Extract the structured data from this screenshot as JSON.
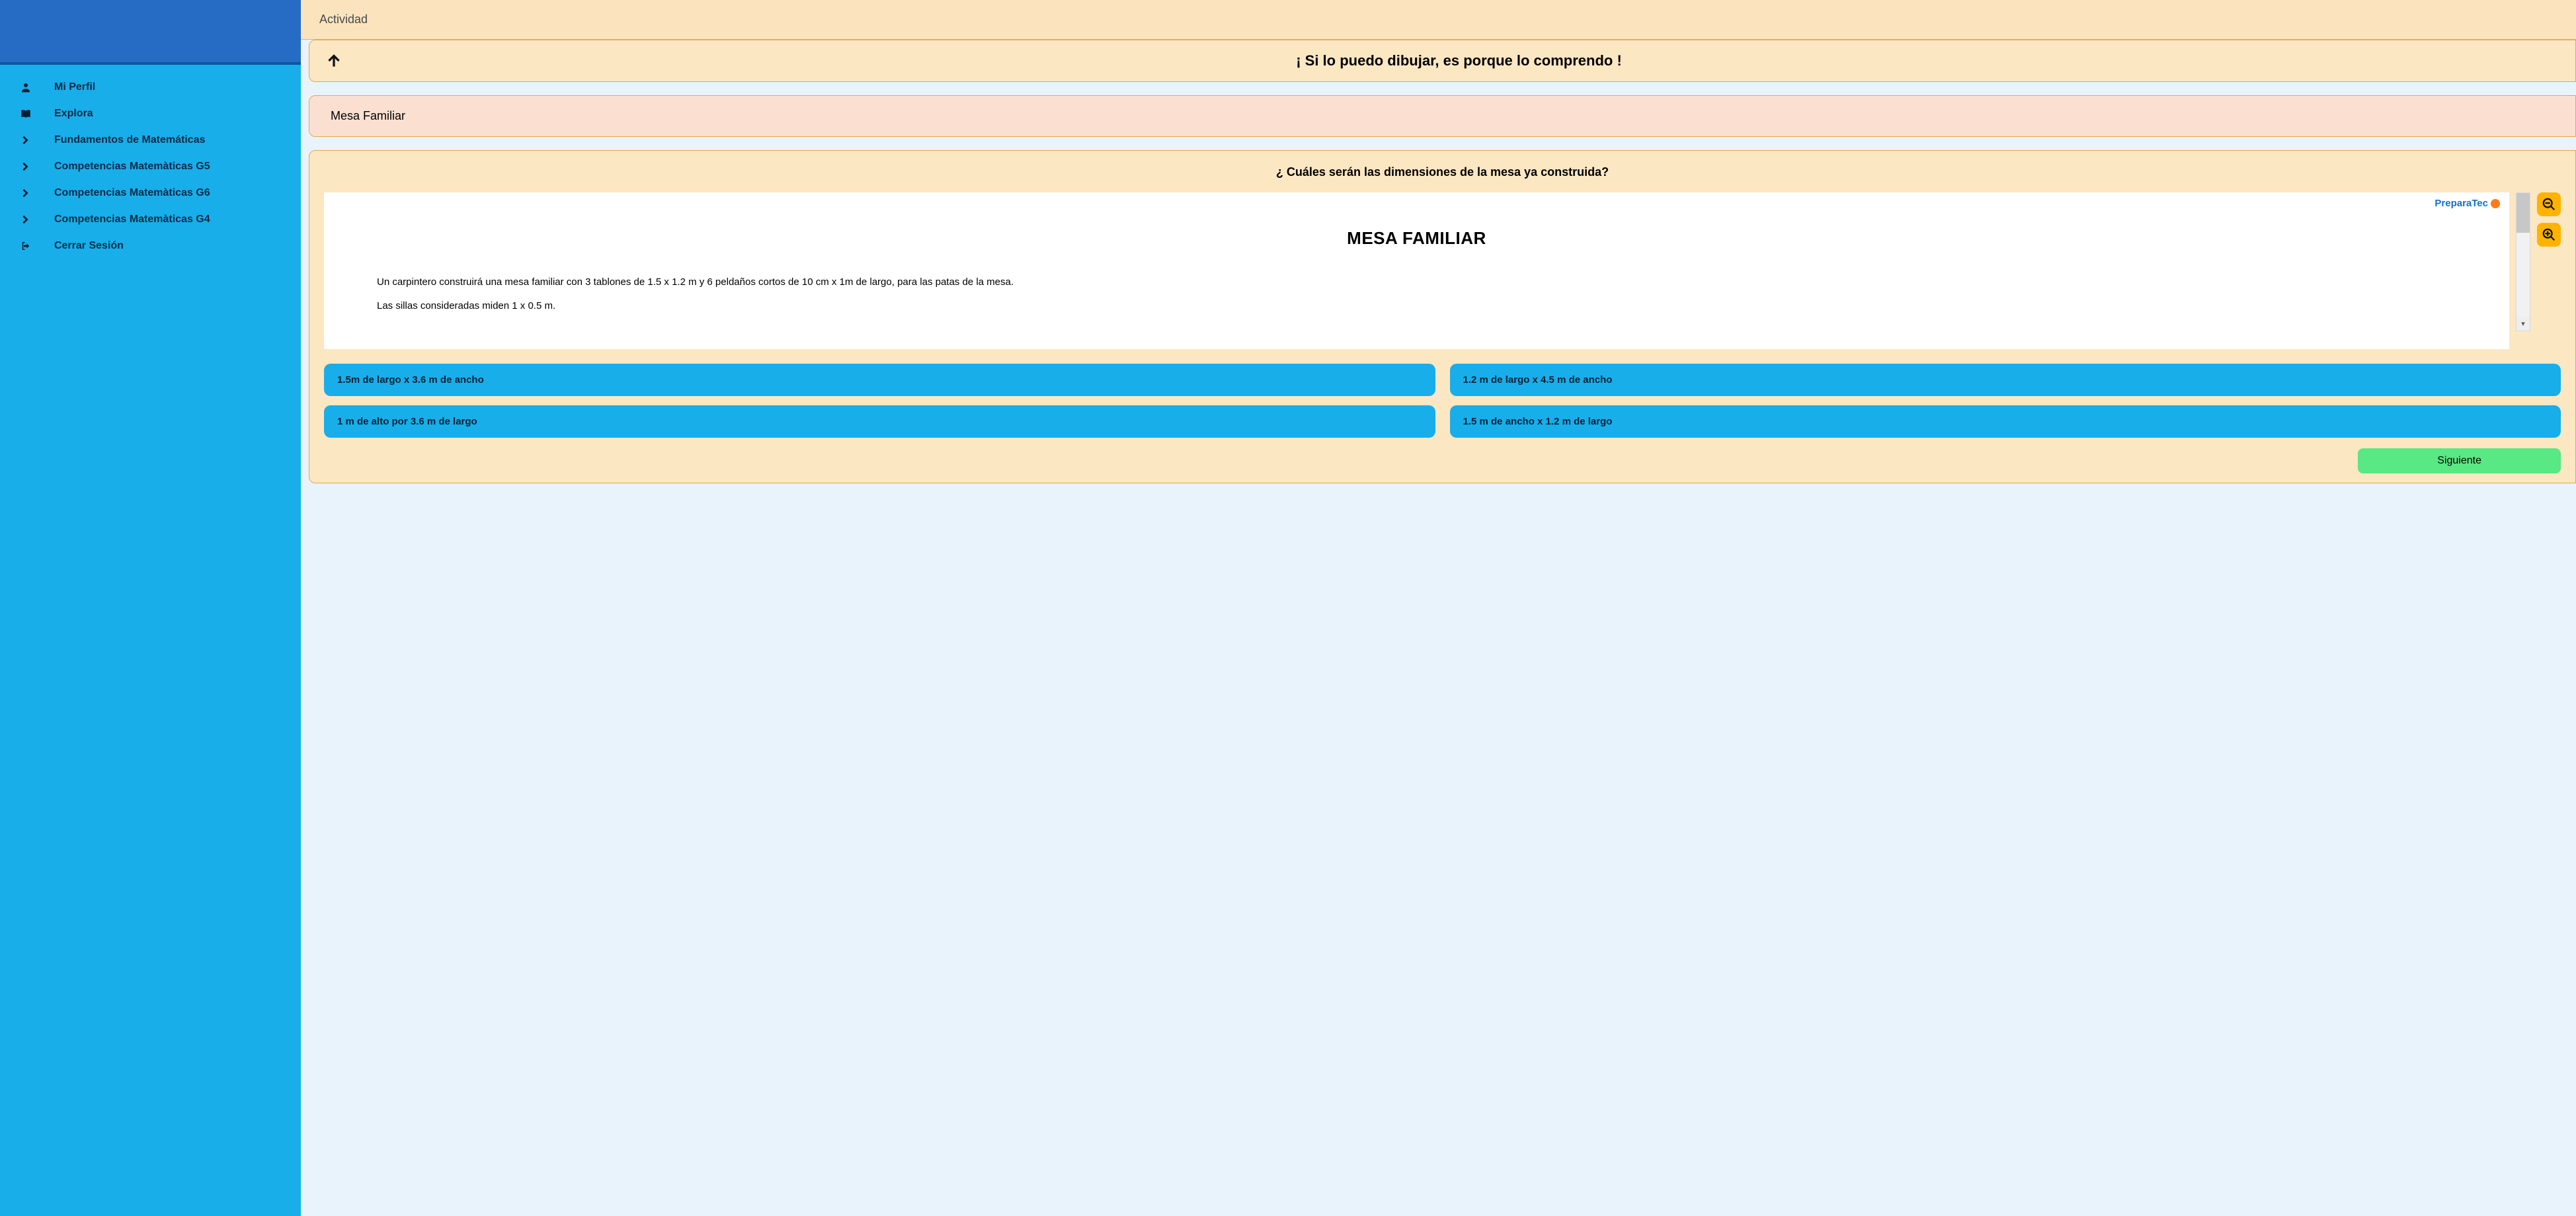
{
  "sidebar": {
    "items": [
      {
        "icon": "user-icon",
        "label": "Mi Perfil"
      },
      {
        "icon": "book-icon",
        "label": "Explora"
      },
      {
        "icon": "chevron-right-icon",
        "label": "Fundamentos de Matemáticas"
      },
      {
        "icon": "chevron-right-icon",
        "label": "Competencias Matemàticas G5"
      },
      {
        "icon": "chevron-right-icon",
        "label": "Competencias Matemàticas G6"
      },
      {
        "icon": "chevron-right-icon",
        "label": "Competencias Matemàticas G4"
      },
      {
        "icon": "logout-icon",
        "label": "Cerrar Sesión"
      }
    ]
  },
  "topbar": {
    "title": "Actividad"
  },
  "activity": {
    "title": "¡ Si lo puedo dibujar, es porque lo comprendo !",
    "subject": "Mesa Familiar",
    "question": "¿ Cuáles serán las dimensiones de la mesa ya construida?",
    "doc": {
      "brand": "PreparaTec",
      "heading": "MESA FAMILIAR",
      "p1": "Un carpintero construirá una mesa familiar con 3 tablones de 1.5 x 1.2 m y 6 peldaños cortos de 10 cm x 1m de largo, para las patas de la mesa.",
      "p2": "Las sillas consideradas miden  1 x 0.5 m."
    },
    "answers": [
      "1.5m de largo x 3.6 m de ancho",
      "1.2 m de largo x 4.5 m de ancho",
      "1 m de alto por 3.6 m de largo",
      "1.5 m de ancho x 1.2 m de largo"
    ],
    "next_label": "Siguiente"
  }
}
